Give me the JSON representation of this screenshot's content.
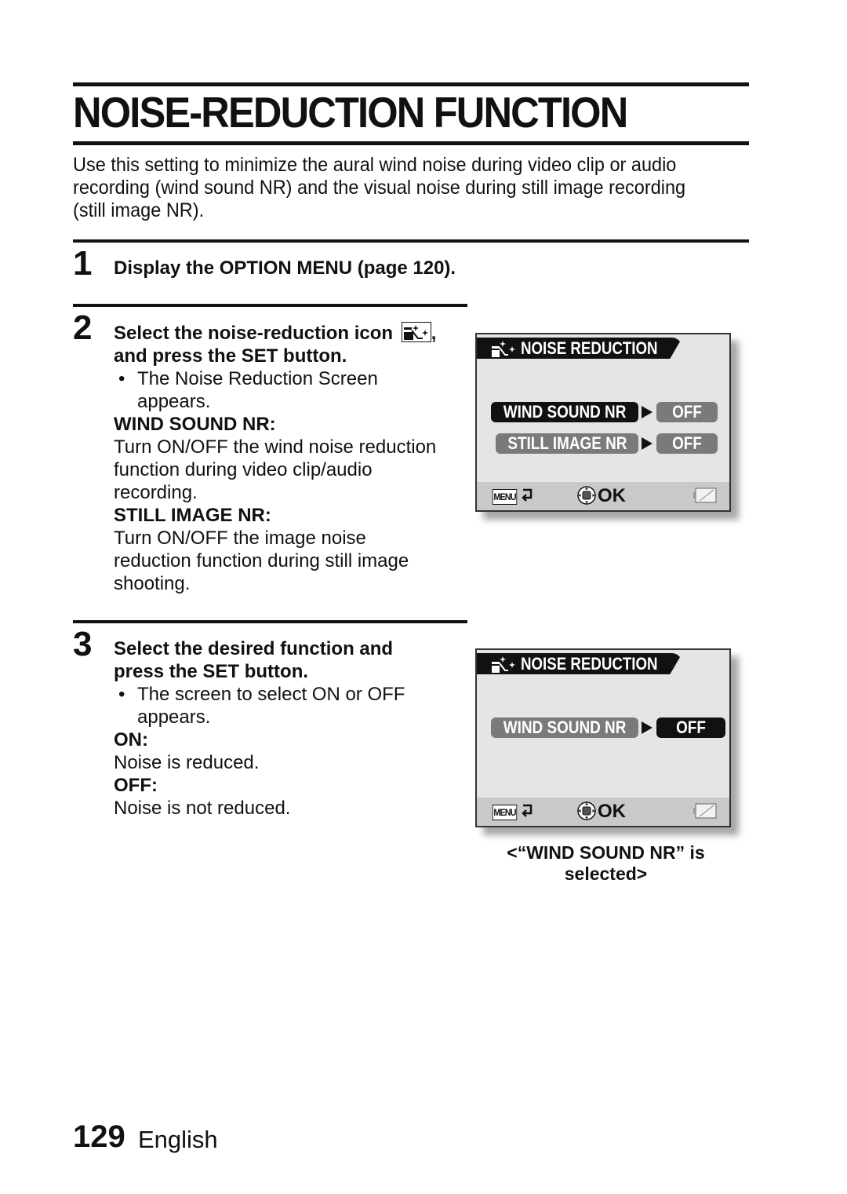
{
  "page": {
    "title": "NOISE-REDUCTION FUNCTION",
    "intro": "Use this setting to minimize the aural wind noise during video clip or audio recording (wind sound NR) and the visual noise during still image recording (still image NR).",
    "footer": {
      "page_number": "129",
      "language": "English"
    }
  },
  "steps": [
    {
      "number": "1",
      "heading": "Display the OPTION MENU (page 120)."
    },
    {
      "number": "2",
      "heading_part1": "Select the noise-reduction icon",
      "heading_part2": ",",
      "heading_line2": "and press the SET button.",
      "bullet": "The Noise Reduction Screen appears.",
      "bullet_line1": "The Noise Reduction Screen",
      "bullet_line2": "appears.",
      "defs": [
        {
          "term": "WIND SOUND NR:",
          "lines": [
            "Turn ON/OFF the wind noise reduction",
            "function during video clip/audio",
            "recording."
          ]
        },
        {
          "term": "STILL IMAGE NR:",
          "lines": [
            "Turn ON/OFF the image noise",
            "reduction function during still image",
            "shooting."
          ]
        }
      ]
    },
    {
      "number": "3",
      "heading_line1": "Select the desired function and",
      "heading_line2": "press the SET button.",
      "bullet_line1": "The screen to select ON or OFF",
      "bullet_line2": "appears.",
      "defs": [
        {
          "term": "ON:",
          "lines": [
            "Noise is reduced."
          ]
        },
        {
          "term": "OFF:",
          "lines": [
            "Noise is not reduced."
          ]
        }
      ]
    }
  ],
  "screens": [
    {
      "header": "NOISE REDUCTION",
      "rows": [
        {
          "name": "WIND SOUND NR",
          "value": "OFF",
          "name_selected": true,
          "value_selected": false
        },
        {
          "name": "STILL IMAGE NR",
          "value": "OFF",
          "name_selected": false,
          "value_selected": false
        }
      ],
      "footer": {
        "menu_label": "MENU",
        "ok_label": "OK"
      }
    },
    {
      "header": "NOISE REDUCTION",
      "rows": [
        {
          "name": "WIND SOUND NR",
          "value": "OFF",
          "name_selected": false,
          "value_selected": true
        }
      ],
      "footer": {
        "menu_label": "MENU",
        "ok_label": "OK"
      },
      "caption_line1": "<“WIND SOUND NR” is",
      "caption_line2": "selected>"
    }
  ],
  "bullet_char": "•"
}
